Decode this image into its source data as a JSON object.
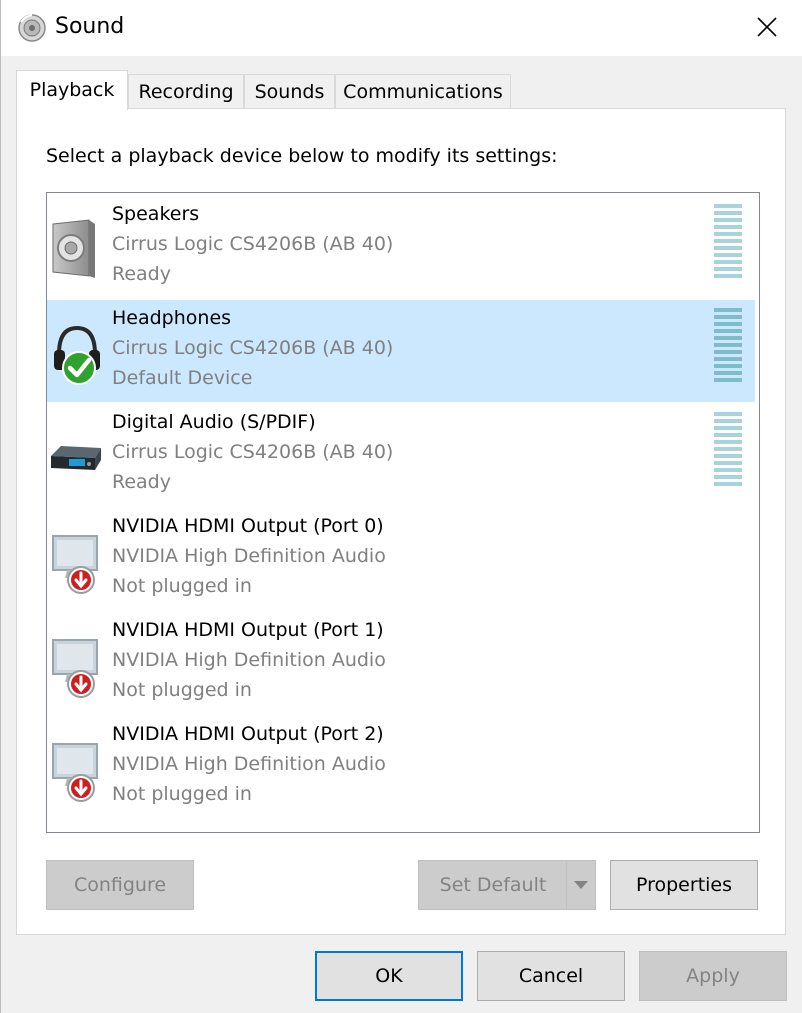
{
  "window": {
    "title": "Sound"
  },
  "tabs": [
    {
      "label": "Playback",
      "active": true
    },
    {
      "label": "Recording",
      "active": false
    },
    {
      "label": "Sounds",
      "active": false
    },
    {
      "label": "Communications",
      "active": false
    }
  ],
  "playback": {
    "instruction": "Select a playback device below to modify its settings:",
    "devices": [
      {
        "name": "Speakers",
        "driver": "Cirrus Logic CS4206B (AB 40)",
        "status": "Ready",
        "icon": "speaker-icon",
        "selected": false
      },
      {
        "name": "Headphones",
        "driver": "Cirrus Logic CS4206B (AB 40)",
        "status": "Default Device",
        "icon": "headphones-icon",
        "selected": true
      },
      {
        "name": "Digital Audio (S/PDIF)",
        "driver": "Cirrus Logic CS4206B (AB 40)",
        "status": "Ready",
        "icon": "digital-audio-icon",
        "selected": false
      },
      {
        "name": "NVIDIA HDMI Output (Port 0)",
        "driver": "NVIDIA High Definition Audio",
        "status": "Not plugged in",
        "icon": "monitor-icon",
        "selected": false
      },
      {
        "name": "NVIDIA HDMI Output (Port 1)",
        "driver": "NVIDIA High Definition Audio",
        "status": "Not plugged in",
        "icon": "monitor-icon",
        "selected": false
      },
      {
        "name": "NVIDIA HDMI Output (Port 2)",
        "driver": "NVIDIA High Definition Audio",
        "status": "Not plugged in",
        "icon": "monitor-icon",
        "selected": false
      }
    ]
  },
  "buttons": {
    "configure": "Configure",
    "set_default": "Set Default",
    "properties": "Properties",
    "ok": "OK",
    "cancel": "Cancel",
    "apply": "Apply"
  },
  "colors": {
    "selection": "#cce8ff",
    "focus_border": "#0078d7",
    "secondary_text": "#808080",
    "meter": "#a9d3dc"
  }
}
